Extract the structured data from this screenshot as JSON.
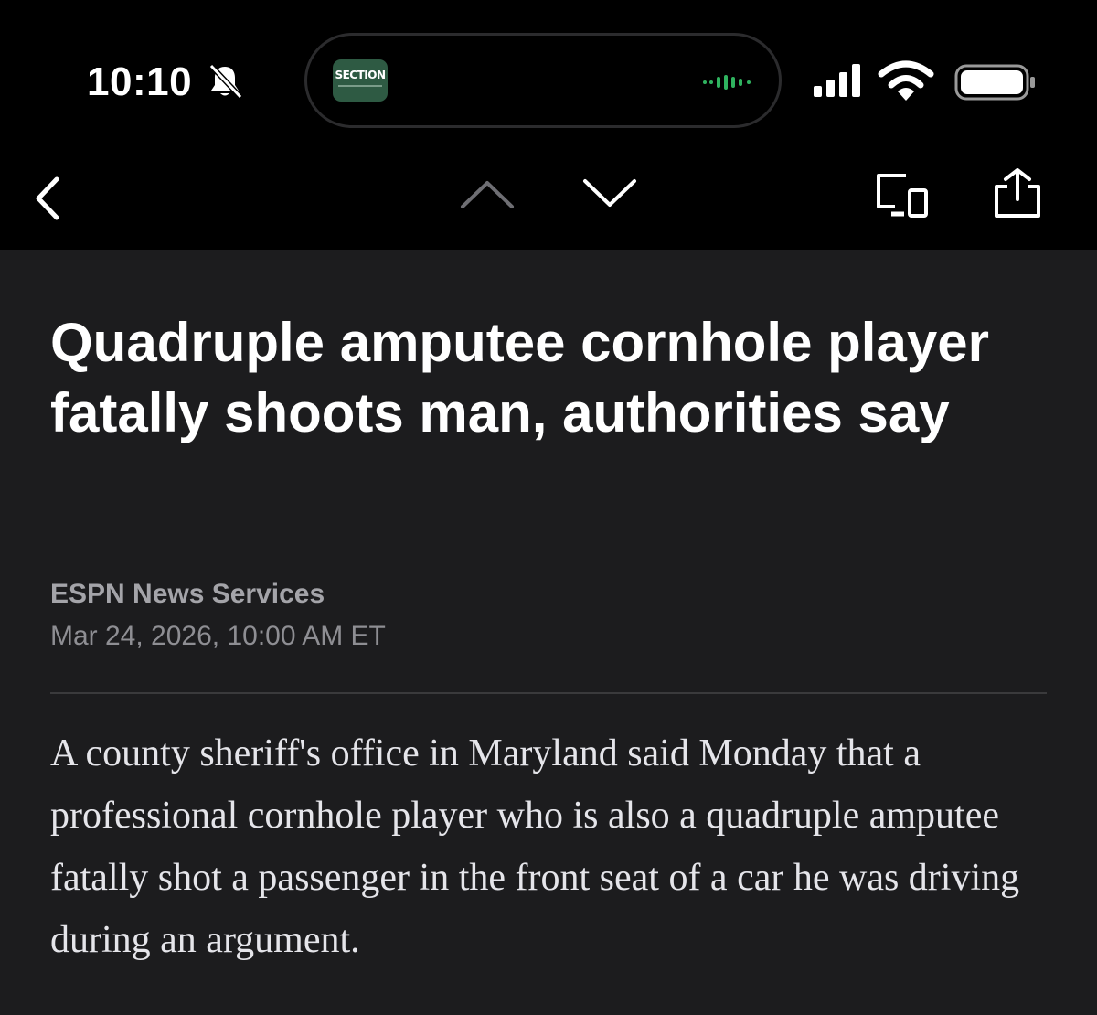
{
  "status_bar": {
    "time": "10:10",
    "notification_icon": "bell-slash-icon",
    "live_activity": {
      "app_icon_label": "SECTION",
      "app_icon_color": "#2e5a43",
      "indicator_icon": "audio-wave-icon"
    },
    "icons": [
      "cellular-signal-icon",
      "wifi-icon",
      "battery-icon"
    ]
  },
  "nav": {
    "icons": [
      "back-chevron-icon",
      "previous-article-icon",
      "next-article-icon",
      "devices-icon",
      "share-icon"
    ]
  },
  "article": {
    "headline": "Quadruple amputee cornhole player fatally shoots man, authorities say",
    "byline": "ESPN News Services",
    "date": "Mar 24, 2026, 10:00 AM ET",
    "body": "A county sheriff's office in Maryland said Monday that a professional cornhole player who is also a quadruple amputee fatally shot a passenger in the front seat of a car he was driving during an argument."
  },
  "colors": {
    "background": "#1c1c1e",
    "bars": "#000000",
    "headline": "#ffffff",
    "meta": "#8e8e93",
    "body": "#e5e5ea"
  }
}
